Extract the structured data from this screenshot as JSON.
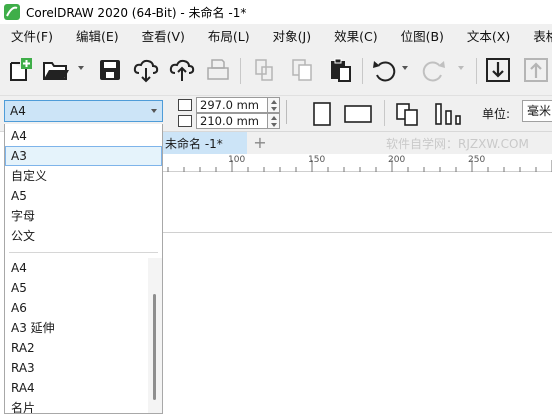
{
  "window": {
    "title": "CorelDRAW 2020 (64-Bit) - 未命名 -1*"
  },
  "menu": {
    "items": [
      {
        "label": "文件(F)"
      },
      {
        "label": "编辑(E)"
      },
      {
        "label": "查看(V)"
      },
      {
        "label": "布局(L)"
      },
      {
        "label": "对象(J)"
      },
      {
        "label": "效果(C)"
      },
      {
        "label": "位图(B)"
      },
      {
        "label": "文本(X)"
      },
      {
        "label": "表格(T)"
      }
    ]
  },
  "toolbar": {
    "icons": [
      "new-document-icon",
      "open-folder-icon",
      "save-icon",
      "import-cloud-icon",
      "export-cloud-icon",
      "print-icon",
      "cut-icon",
      "copy-icon",
      "paste-icon",
      "undo-icon",
      "redo-icon",
      "import-icon",
      "export-icon"
    ]
  },
  "property_bar": {
    "page_preset": "A4",
    "width": "297.0 mm",
    "height": "210.0 mm",
    "unit_label": "单位:",
    "unit_value": "毫米"
  },
  "document_tab": {
    "label": "未命名 -1*",
    "add_label": "+"
  },
  "watermark": "软件自学网：RJZXW.COM",
  "ruler": {
    "labels": [
      "100",
      "150",
      "200",
      "250"
    ]
  },
  "page_size_dropdown": {
    "items_top": [
      "A4",
      "A3",
      "自定义",
      "A5",
      "字母",
      "公文"
    ],
    "selected": "A3",
    "items_bottom": [
      "A4",
      "A5",
      "A6",
      "A3 延伸",
      "RA2",
      "RA3",
      "RA4",
      "名片"
    ]
  },
  "colors": {
    "accent": "#4f9cd8",
    "selection_bg": "#cce4f7",
    "chrome": "#f0f0f0",
    "logo_green": "#3fae49"
  }
}
